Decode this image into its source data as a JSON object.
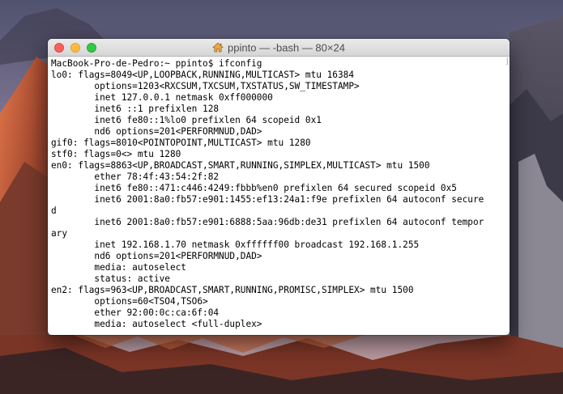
{
  "window": {
    "title": "ppinto — -bash — 80×24"
  },
  "terminal": {
    "lines": [
      "MacBook-Pro-de-Pedro:~ ppinto$ ifconfig",
      "lo0: flags=8049<UP,LOOPBACK,RUNNING,MULTICAST> mtu 16384",
      "        options=1203<RXCSUM,TXCSUM,TXSTATUS,SW_TIMESTAMP>",
      "        inet 127.0.0.1 netmask 0xff000000",
      "        inet6 ::1 prefixlen 128",
      "        inet6 fe80::1%lo0 prefixlen 64 scopeid 0x1",
      "        nd6 options=201<PERFORMNUD,DAD>",
      "gif0: flags=8010<POINTOPOINT,MULTICAST> mtu 1280",
      "stf0: flags=0<> mtu 1280",
      "en0: flags=8863<UP,BROADCAST,SMART,RUNNING,SIMPLEX,MULTICAST> mtu 1500",
      "        ether 78:4f:43:54:2f:82",
      "        inet6 fe80::471:c446:4249:fbbb%en0 prefixlen 64 secured scopeid 0x5",
      "        inet6 2001:8a0:fb57:e901:1455:ef13:24a1:f9e prefixlen 64 autoconf secure",
      "d",
      "        inet6 2001:8a0:fb57:e901:6888:5aa:96db:de31 prefixlen 64 autoconf tempor",
      "ary",
      "        inet 192.168.1.70 netmask 0xffffff00 broadcast 192.168.1.255",
      "        nd6 options=201<PERFORMNUD,DAD>",
      "        media: autoselect",
      "        status: active",
      "en2: flags=963<UP,BROADCAST,SMART,RUNNING,PROMISC,SIMPLEX> mtu 1500",
      "        options=60<TSO4,TSO6>",
      "        ether 92:00:0c:ca:6f:04",
      "        media: autoselect <full-duplex>"
    ]
  },
  "colors": {
    "close": "#fc605c",
    "minimize": "#fdbc40",
    "maximize": "#34c84a"
  },
  "icons": {
    "title_icon": "home-icon"
  }
}
